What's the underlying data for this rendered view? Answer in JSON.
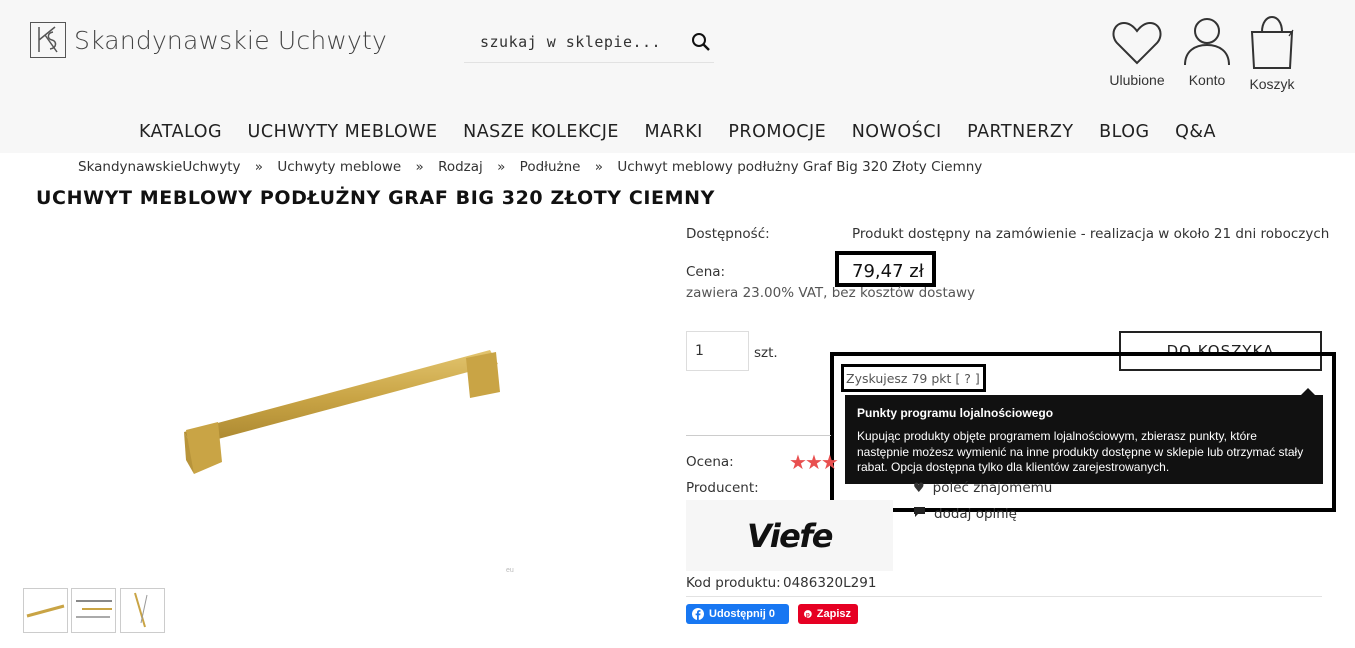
{
  "brand": {
    "name": "Skandynawskie Uchwyty"
  },
  "search": {
    "placeholder": "szukaj w sklepie..."
  },
  "header_icons": {
    "favorites": "Ulubione",
    "account": "Konto",
    "cart": "Koszyk"
  },
  "nav": [
    "KATALOG",
    "UCHWYTY MEBLOWE",
    "NASZE KOLEKCJE",
    "MARKI",
    "PROMOCJE",
    "NOWOŚCI",
    "PARTNERZY",
    "BLOG",
    "Q&A"
  ],
  "breadcrumb": [
    "SkandynawskieUchwyty",
    "Uchwyty meblowe",
    "Rodzaj",
    "Podłużne",
    "Uchwyt meblowy podłużny Graf Big 320 Złoty Ciemny"
  ],
  "breadcrumb_separator": "»",
  "product": {
    "title": "UCHWYT MEBLOWY PODŁUŻNY GRAF BIG 320 ZŁOTY CIEMNY",
    "availability_label": "Dostępność:",
    "availability_value": "Produkt dostępny na zamówienie - realizacja w około 21 dni roboczych",
    "price_label": "Cena:",
    "price": "79,47 zł",
    "price_note": "zawiera 23.00% VAT, bez kosztów dostawy",
    "quantity": "1",
    "quantity_unit": "szt.",
    "add_to_cart": "DO KOSZYKA",
    "points": "Zyskujesz 79 pkt [ ? ]",
    "rating_label": "Ocena:",
    "producer_label": "Producent:",
    "producer_logo_text": "Viefe",
    "product_code_label": "Kod produktu:",
    "product_code": "0486320L291",
    "image_tag": "eu"
  },
  "tooltip": {
    "title": "Punkty programu lojalnościowego",
    "body": "Kupując produkty objęte programem lojalnościowym, zbierasz punkty, które następnie możesz wymienić na inne produkty dostępne w sklepie lub otrzymać stały rabat. Opcja dostępna tylko dla klientów zarejestrowanych."
  },
  "actions": {
    "recommend": "poleć znajomemu",
    "add_review": "dodaj opinię"
  },
  "share": {
    "facebook": "Udostępnij 0",
    "pinterest": "Zapisz"
  },
  "colors": {
    "accent_gold": "#c9a445",
    "star_red": "#e84f4f",
    "facebook": "#1877f2",
    "pinterest": "#e60023"
  }
}
